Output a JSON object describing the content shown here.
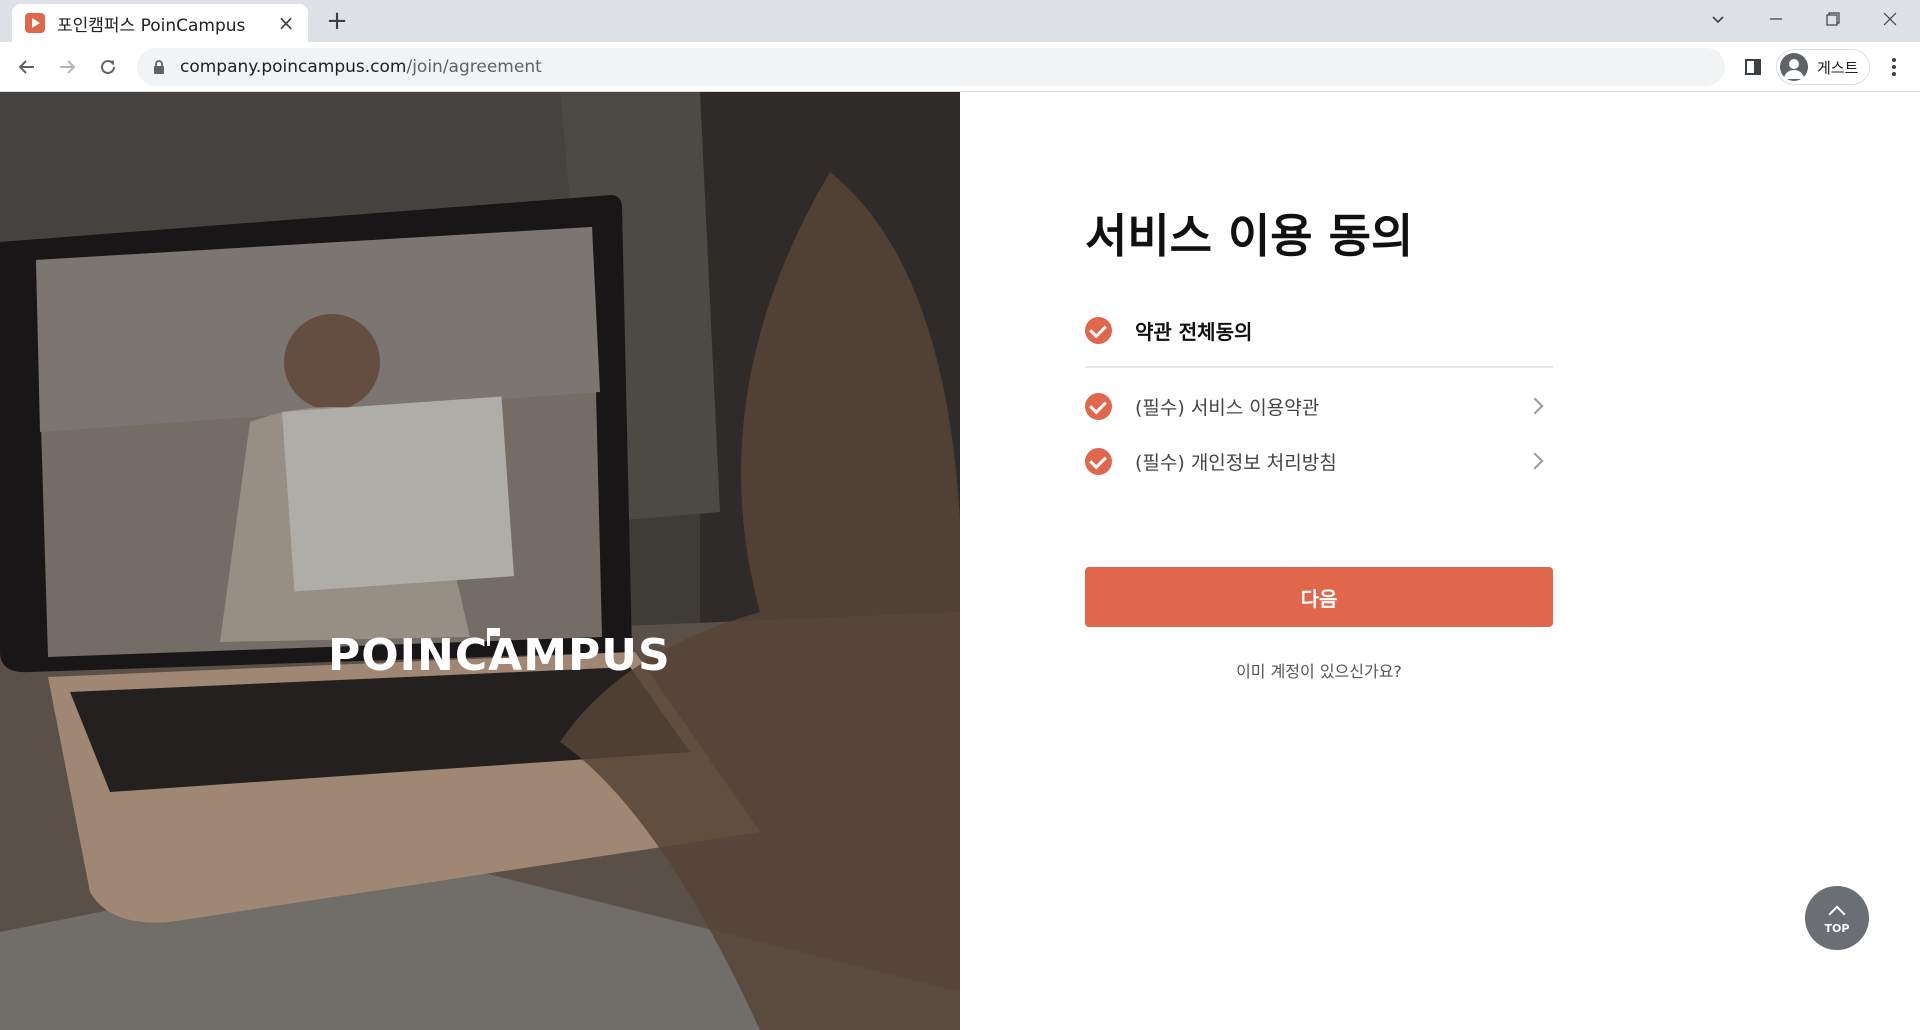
{
  "browser": {
    "tab_title": "포인캠퍼스 PoinCampus",
    "tab_close": "×",
    "new_tab": "+",
    "url_host": "company.poincampus.com",
    "url_path": "/join/agreement",
    "profile_name": "게스트"
  },
  "hero": {
    "brand_logo": "POINCAMPUS"
  },
  "agreement": {
    "title": "서비스 이용 동의",
    "agree_all_label": "약관 전체동의",
    "terms": [
      {
        "label": "(필수) 서비스 이용약관"
      },
      {
        "label": "(필수) 개인정보 처리방침"
      }
    ],
    "next_button": "다음",
    "login_link": "이미 계정이 있으신가요?"
  },
  "scroll_top": {
    "label": "TOP"
  },
  "colors": {
    "accent": "#e0674c",
    "top_button": "#6b6f73"
  },
  "icons": [
    "favicon-icon",
    "close-icon",
    "plus-icon",
    "chevron-down-icon",
    "minimize-icon",
    "maximize-icon",
    "window-close-icon",
    "back-icon",
    "forward-icon",
    "reload-icon",
    "lock-icon",
    "side-panel-icon",
    "profile-icon",
    "more-menu-icon",
    "check-icon",
    "chevron-right-icon",
    "arrow-up-icon"
  ]
}
